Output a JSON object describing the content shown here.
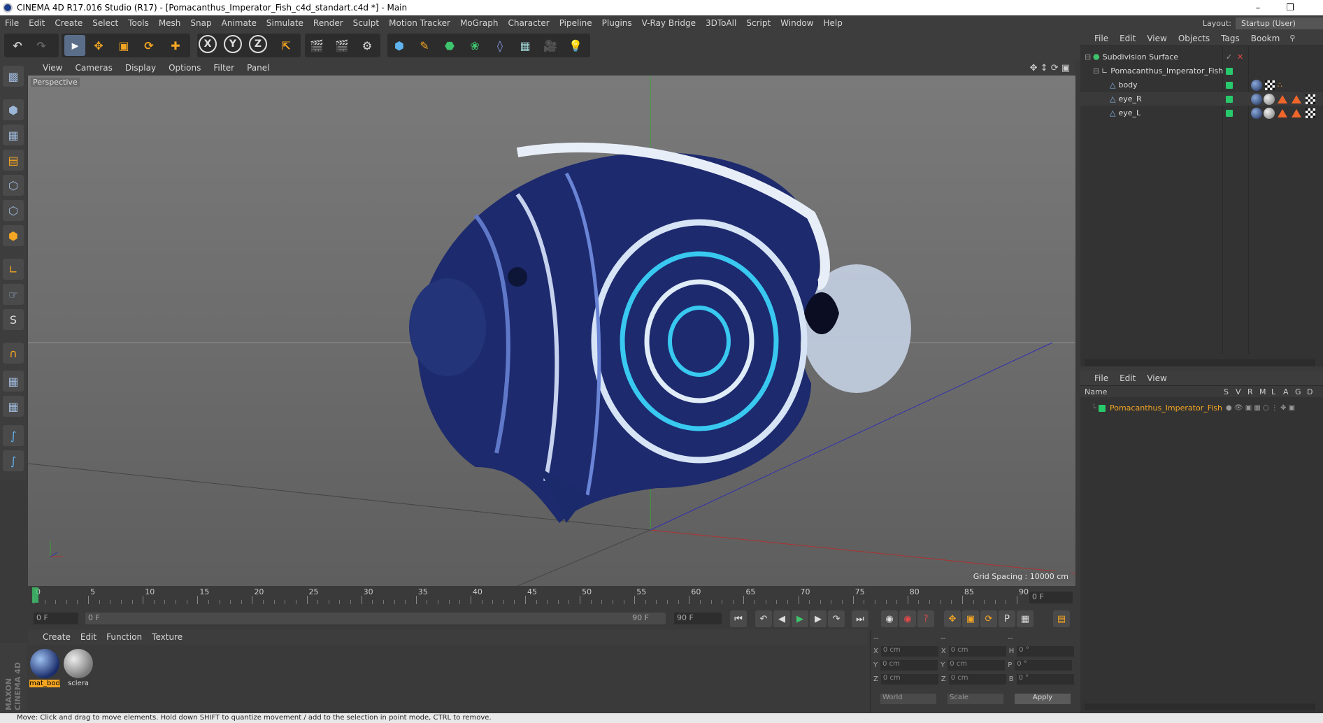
{
  "window": {
    "title": "CINEMA 4D R17.016 Studio (R17) - [Pomacanthus_Imperator_Fish_c4d_standart.c4d *] - Main"
  },
  "menubar": [
    "File",
    "Edit",
    "Create",
    "Select",
    "Tools",
    "Mesh",
    "Snap",
    "Animate",
    "Simulate",
    "Render",
    "Sculpt",
    "Motion Tracker",
    "MoGraph",
    "Character",
    "Pipeline",
    "Plugins",
    "V-Ray Bridge",
    "3DToAll",
    "Script",
    "Window",
    "Help"
  ],
  "layout": {
    "label": "Layout:",
    "value": "Startup (User)"
  },
  "viewport": {
    "menu": [
      "View",
      "Cameras",
      "Display",
      "Options",
      "Filter",
      "Panel"
    ],
    "label": "Perspective",
    "grid_spacing": "Grid Spacing : 10000 cm"
  },
  "timeline": {
    "ticks": [
      "0",
      "5",
      "10",
      "15",
      "20",
      "25",
      "30",
      "35",
      "40",
      "45",
      "50",
      "55",
      "60",
      "65",
      "70",
      "75",
      "80",
      "85",
      "90"
    ],
    "current_frame": "0 F"
  },
  "playbar": {
    "start": "0 F",
    "range_start": "0 F",
    "range_end": "90 F",
    "end": "90 F"
  },
  "materials": {
    "menu": [
      "Create",
      "Edit",
      "Function",
      "Texture"
    ],
    "items": [
      {
        "name": "mat_bod",
        "selected": true
      },
      {
        "name": "sclera",
        "selected": false
      }
    ]
  },
  "coords": {
    "header_left": "--",
    "header_mid": "--",
    "header_right": "--",
    "rows": [
      {
        "a": "X",
        "av": "0 cm",
        "b": "X",
        "bv": "0 cm",
        "c": "H",
        "cv": "0 °"
      },
      {
        "a": "Y",
        "av": "0 cm",
        "b": "Y",
        "bv": "0 cm",
        "c": "P",
        "cv": "0 °"
      },
      {
        "a": "Z",
        "av": "0 cm",
        "b": "Z",
        "bv": "0 cm",
        "c": "B",
        "cv": "0 °"
      }
    ],
    "world": "World",
    "scale": "Scale",
    "apply": "Apply"
  },
  "objects": {
    "menu": [
      "File",
      "Edit",
      "View",
      "Objects",
      "Tags",
      "Bookm"
    ],
    "tree": [
      {
        "name": "Subdivision Surface",
        "indent": 0
      },
      {
        "name": "Pomacanthus_Imperator_Fish",
        "indent": 1
      },
      {
        "name": "body",
        "indent": 2
      },
      {
        "name": "eye_R",
        "indent": 2
      },
      {
        "name": "eye_L",
        "indent": 2
      }
    ]
  },
  "attributes": {
    "menu": [
      "File",
      "Edit",
      "View"
    ],
    "name_header": "Name",
    "col_headers": [
      "S",
      "V",
      "R",
      "M",
      "L",
      "A",
      "G",
      "D"
    ],
    "item": "Pomacanthus_Imperator_Fish"
  },
  "status": "Move: Click and drag to move elements. Hold down SHIFT to quantize movement / add to the selection in point mode, CTRL to remove.",
  "maxon": "MAXON CINEMA 4D",
  "colors": {
    "accent_orange": "#f5a623",
    "green_tag": "#28c96b"
  }
}
